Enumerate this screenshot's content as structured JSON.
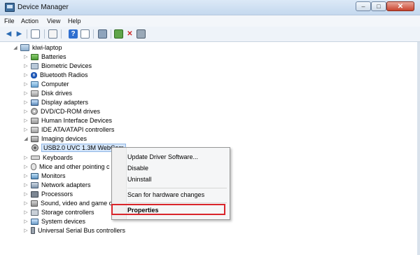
{
  "window": {
    "title": "Device Manager",
    "close_glyph": "✕",
    "maximize_glyph": "□",
    "minimize_glyph": "–"
  },
  "menubar": {
    "items": [
      "File",
      "Action",
      "View",
      "Help"
    ]
  },
  "toolbar": {
    "icons": [
      "back-arrow-icon",
      "forward-arrow-icon",
      "properties-view-icon",
      "list-icon",
      "help-icon",
      "details-icon",
      "scan-hardware-icon",
      "update-driver-icon",
      "disable-device-icon",
      "uninstall-device-icon"
    ]
  },
  "tree": {
    "root": {
      "label": "kiwi-laptop",
      "expanded": true
    },
    "categories": [
      {
        "label": "Batteries",
        "icon": "battery-icon"
      },
      {
        "label": "Biometric Devices",
        "icon": "biometric-icon"
      },
      {
        "label": "Bluetooth Radios",
        "icon": "bluetooth-icon",
        "glyph": "ʙ"
      },
      {
        "label": "Computer",
        "icon": "computer-icon"
      },
      {
        "label": "Disk drives",
        "icon": "disk-drive-icon"
      },
      {
        "label": "Display adapters",
        "icon": "display-adapter-icon"
      },
      {
        "label": "DVD/CD-ROM drives",
        "icon": "dvd-drive-icon"
      },
      {
        "label": "Human Interface Devices",
        "icon": "hid-icon"
      },
      {
        "label": "IDE ATA/ATAPI controllers",
        "icon": "ide-controller-icon"
      },
      {
        "label": "Imaging devices",
        "icon": "imaging-device-icon",
        "expanded": true
      },
      {
        "label": "Keyboards",
        "icon": "keyboard-icon"
      },
      {
        "label": "Mice and other pointing c",
        "icon": "mouse-icon"
      },
      {
        "label": "Monitors",
        "icon": "monitor-icon"
      },
      {
        "label": "Network adapters",
        "icon": "network-adapter-icon"
      },
      {
        "label": "Processors",
        "icon": "processor-icon"
      },
      {
        "label": "Sound, video and game co",
        "icon": "sound-icon"
      },
      {
        "label": "Storage controllers",
        "icon": "storage-controller-icon"
      },
      {
        "label": "System devices",
        "icon": "system-device-icon"
      },
      {
        "label": "Universal Serial Bus controllers",
        "icon": "usb-icon"
      }
    ],
    "child": {
      "label": "USB2.0 UVC 1.3M WebCam",
      "icon": "webcam-icon",
      "selected": true
    }
  },
  "context_menu": {
    "items": [
      "Update Driver Software...",
      "Disable",
      "Uninstall",
      "Scan for hardware changes",
      "Properties"
    ],
    "highlighted": "Properties",
    "highlight_color": "#d9252b"
  }
}
